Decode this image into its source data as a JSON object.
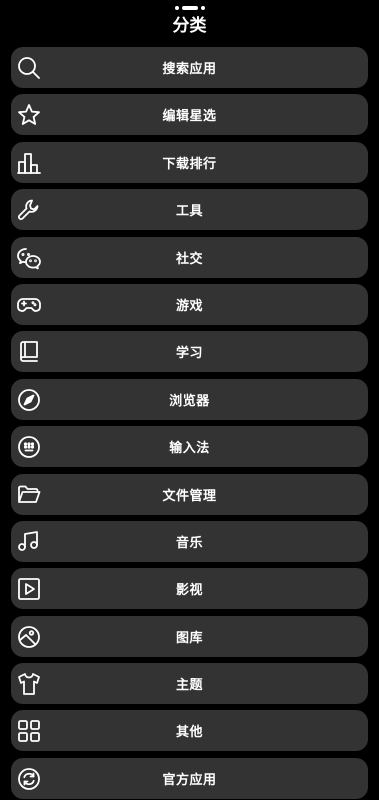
{
  "header": {
    "title": "分类"
  },
  "menu": {
    "items": [
      {
        "label": "搜索应用",
        "icon": "search-icon"
      },
      {
        "label": "编辑星选",
        "icon": "star-icon"
      },
      {
        "label": "下载排行",
        "icon": "bar-chart-icon"
      },
      {
        "label": "工具",
        "icon": "wrench-icon"
      },
      {
        "label": "社交",
        "icon": "wechat-icon"
      },
      {
        "label": "游戏",
        "icon": "gamepad-icon"
      },
      {
        "label": "学习",
        "icon": "book-icon"
      },
      {
        "label": "浏览器",
        "icon": "compass-icon"
      },
      {
        "label": "输入法",
        "icon": "keypad-icon"
      },
      {
        "label": "文件管理",
        "icon": "folder-icon"
      },
      {
        "label": "音乐",
        "icon": "music-note-icon"
      },
      {
        "label": "影视",
        "icon": "play-icon"
      },
      {
        "label": "图库",
        "icon": "image-icon"
      },
      {
        "label": "主题",
        "icon": "shirt-icon"
      },
      {
        "label": "其他",
        "icon": "grid-icon"
      },
      {
        "label": "官方应用",
        "icon": "refresh-icon"
      }
    ]
  }
}
